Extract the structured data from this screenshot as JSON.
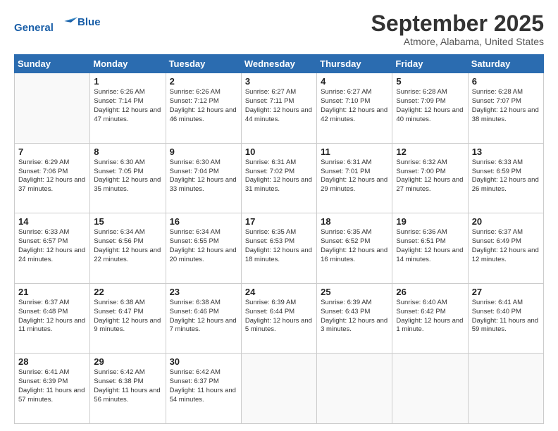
{
  "header": {
    "logo_line1": "General",
    "logo_line2": "Blue",
    "month": "September 2025",
    "location": "Atmore, Alabama, United States"
  },
  "days_of_week": [
    "Sunday",
    "Monday",
    "Tuesday",
    "Wednesday",
    "Thursday",
    "Friday",
    "Saturday"
  ],
  "weeks": [
    [
      {
        "day": "",
        "text": ""
      },
      {
        "day": "1",
        "text": "Sunrise: 6:26 AM\nSunset: 7:14 PM\nDaylight: 12 hours and 47 minutes."
      },
      {
        "day": "2",
        "text": "Sunrise: 6:26 AM\nSunset: 7:12 PM\nDaylight: 12 hours and 46 minutes."
      },
      {
        "day": "3",
        "text": "Sunrise: 6:27 AM\nSunset: 7:11 PM\nDaylight: 12 hours and 44 minutes."
      },
      {
        "day": "4",
        "text": "Sunrise: 6:27 AM\nSunset: 7:10 PM\nDaylight: 12 hours and 42 minutes."
      },
      {
        "day": "5",
        "text": "Sunrise: 6:28 AM\nSunset: 7:09 PM\nDaylight: 12 hours and 40 minutes."
      },
      {
        "day": "6",
        "text": "Sunrise: 6:28 AM\nSunset: 7:07 PM\nDaylight: 12 hours and 38 minutes."
      }
    ],
    [
      {
        "day": "7",
        "text": "Sunrise: 6:29 AM\nSunset: 7:06 PM\nDaylight: 12 hours and 37 minutes."
      },
      {
        "day": "8",
        "text": "Sunrise: 6:30 AM\nSunset: 7:05 PM\nDaylight: 12 hours and 35 minutes."
      },
      {
        "day": "9",
        "text": "Sunrise: 6:30 AM\nSunset: 7:04 PM\nDaylight: 12 hours and 33 minutes."
      },
      {
        "day": "10",
        "text": "Sunrise: 6:31 AM\nSunset: 7:02 PM\nDaylight: 12 hours and 31 minutes."
      },
      {
        "day": "11",
        "text": "Sunrise: 6:31 AM\nSunset: 7:01 PM\nDaylight: 12 hours and 29 minutes."
      },
      {
        "day": "12",
        "text": "Sunrise: 6:32 AM\nSunset: 7:00 PM\nDaylight: 12 hours and 27 minutes."
      },
      {
        "day": "13",
        "text": "Sunrise: 6:33 AM\nSunset: 6:59 PM\nDaylight: 12 hours and 26 minutes."
      }
    ],
    [
      {
        "day": "14",
        "text": "Sunrise: 6:33 AM\nSunset: 6:57 PM\nDaylight: 12 hours and 24 minutes."
      },
      {
        "day": "15",
        "text": "Sunrise: 6:34 AM\nSunset: 6:56 PM\nDaylight: 12 hours and 22 minutes."
      },
      {
        "day": "16",
        "text": "Sunrise: 6:34 AM\nSunset: 6:55 PM\nDaylight: 12 hours and 20 minutes."
      },
      {
        "day": "17",
        "text": "Sunrise: 6:35 AM\nSunset: 6:53 PM\nDaylight: 12 hours and 18 minutes."
      },
      {
        "day": "18",
        "text": "Sunrise: 6:35 AM\nSunset: 6:52 PM\nDaylight: 12 hours and 16 minutes."
      },
      {
        "day": "19",
        "text": "Sunrise: 6:36 AM\nSunset: 6:51 PM\nDaylight: 12 hours and 14 minutes."
      },
      {
        "day": "20",
        "text": "Sunrise: 6:37 AM\nSunset: 6:49 PM\nDaylight: 12 hours and 12 minutes."
      }
    ],
    [
      {
        "day": "21",
        "text": "Sunrise: 6:37 AM\nSunset: 6:48 PM\nDaylight: 12 hours and 11 minutes."
      },
      {
        "day": "22",
        "text": "Sunrise: 6:38 AM\nSunset: 6:47 PM\nDaylight: 12 hours and 9 minutes."
      },
      {
        "day": "23",
        "text": "Sunrise: 6:38 AM\nSunset: 6:46 PM\nDaylight: 12 hours and 7 minutes."
      },
      {
        "day": "24",
        "text": "Sunrise: 6:39 AM\nSunset: 6:44 PM\nDaylight: 12 hours and 5 minutes."
      },
      {
        "day": "25",
        "text": "Sunrise: 6:39 AM\nSunset: 6:43 PM\nDaylight: 12 hours and 3 minutes."
      },
      {
        "day": "26",
        "text": "Sunrise: 6:40 AM\nSunset: 6:42 PM\nDaylight: 12 hours and 1 minute."
      },
      {
        "day": "27",
        "text": "Sunrise: 6:41 AM\nSunset: 6:40 PM\nDaylight: 11 hours and 59 minutes."
      }
    ],
    [
      {
        "day": "28",
        "text": "Sunrise: 6:41 AM\nSunset: 6:39 PM\nDaylight: 11 hours and 57 minutes."
      },
      {
        "day": "29",
        "text": "Sunrise: 6:42 AM\nSunset: 6:38 PM\nDaylight: 11 hours and 56 minutes."
      },
      {
        "day": "30",
        "text": "Sunrise: 6:42 AM\nSunset: 6:37 PM\nDaylight: 11 hours and 54 minutes."
      },
      {
        "day": "",
        "text": ""
      },
      {
        "day": "",
        "text": ""
      },
      {
        "day": "",
        "text": ""
      },
      {
        "day": "",
        "text": ""
      }
    ]
  ]
}
